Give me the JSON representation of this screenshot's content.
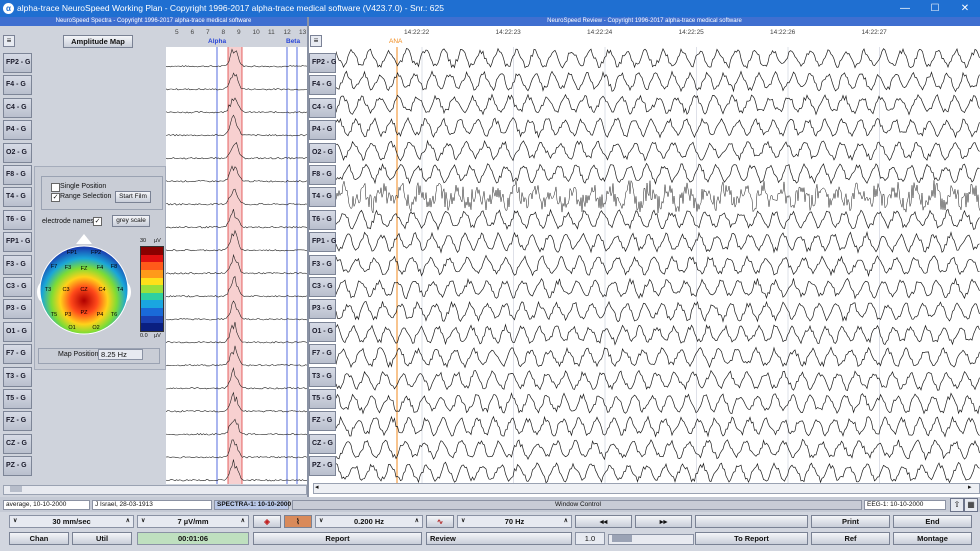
{
  "window": {
    "title": "alpha-trace NeuroSpeed Working Plan - Copyright 1996-2017 alpha-trace medical software (V423.7.0) - Snr.: 625",
    "app_icon": "α",
    "minimize": "—",
    "maximize": "☐",
    "close": "✕"
  },
  "spectra": {
    "header": "NeuroSpeed Spectra - Copyright 1996-2017 alpha-trace medical software",
    "menu_icon": "≡",
    "amplitude_map_button": "Amplitude Map",
    "freq_ticks": [
      "5",
      "6",
      "7",
      "8",
      "9",
      "10",
      "11",
      "12",
      "13"
    ],
    "alpha_label": "Alpha",
    "beta_label": "Beta",
    "single_position": "Single Position",
    "range_selection": "Range Selection",
    "start_film": "Start Film",
    "electrode_names": "electrode names",
    "grey_scale": "grey scale",
    "scale_max": "30",
    "scale_min": "0.0",
    "scale_unit": "µV",
    "map_position_label": "Map Position:",
    "map_position_value": "8.25 Hz",
    "electrodes": [
      "FP1",
      "FP2",
      "F7",
      "F3",
      "FZ",
      "F4",
      "F8",
      "T3",
      "C3",
      "CZ",
      "C4",
      "T4",
      "T5",
      "P3",
      "PZ",
      "P4",
      "T6",
      "O1",
      "O2"
    ],
    "channels": [
      "FP2 - G",
      "F4 - G",
      "C4 - G",
      "P4 - G",
      "O2 - G",
      "F8 - G",
      "T4 - G",
      "T6 - G",
      "FP1 - G",
      "F3 - G",
      "C3 - G",
      "P3 - G",
      "O1 - G",
      "F7 - G",
      "T3 - G",
      "T5 - G",
      "FZ - G",
      "CZ - G",
      "PZ - G"
    ]
  },
  "review": {
    "header": "NeuroSpeed Review - Copyright 1996-2017 alpha-trace medical software",
    "menu_icon": "≡",
    "times": [
      "14:22:22",
      "14:22:23",
      "14:22:24",
      "14:22:25",
      "14:22:26",
      "14:22:27"
    ],
    "marker": "ANA",
    "channels": [
      "FP2 - G",
      "F4 - G",
      "C4 - G",
      "P4 - G",
      "O2 - G",
      "F8 - G",
      "T4 - G",
      "T6 - G",
      "FP1 - G",
      "F3 - G",
      "C3 - G",
      "P3 - G",
      "O1 - G",
      "F7 - G",
      "T3 - G",
      "T5 - G",
      "FZ - G",
      "CZ - G",
      "PZ - G"
    ]
  },
  "status": {
    "montage_info": "average, 10-10-2000",
    "patient": "J Israel, 28-03-1913",
    "spectra_tab": "SPECTRA-1: 10-10-2000",
    "window_control": "Window Control",
    "eeg_tab": "EEG-1: 10-10-2000"
  },
  "toolbar": {
    "speed": "30 mm/sec",
    "sensitivity": "7 µV/mm",
    "low_filter": "0.200 Hz",
    "high_filter": "70 Hz",
    "rewind": "◂◂",
    "forward": "▸▸",
    "print": "Print",
    "end": "End",
    "chan": "Chan",
    "util": "Util",
    "time": "00:01:06",
    "report": "Report",
    "review": "Review",
    "speed_factor": "1.0",
    "to_report": "To Report",
    "ref": "Ref",
    "montage": "Montage"
  },
  "colors": {
    "title_bar": "#1f6fd1",
    "pane_header": "#3f6fd0",
    "alpha_line": "#2a47d8",
    "range_line": "#e04040",
    "marker": "#f08a1c"
  }
}
